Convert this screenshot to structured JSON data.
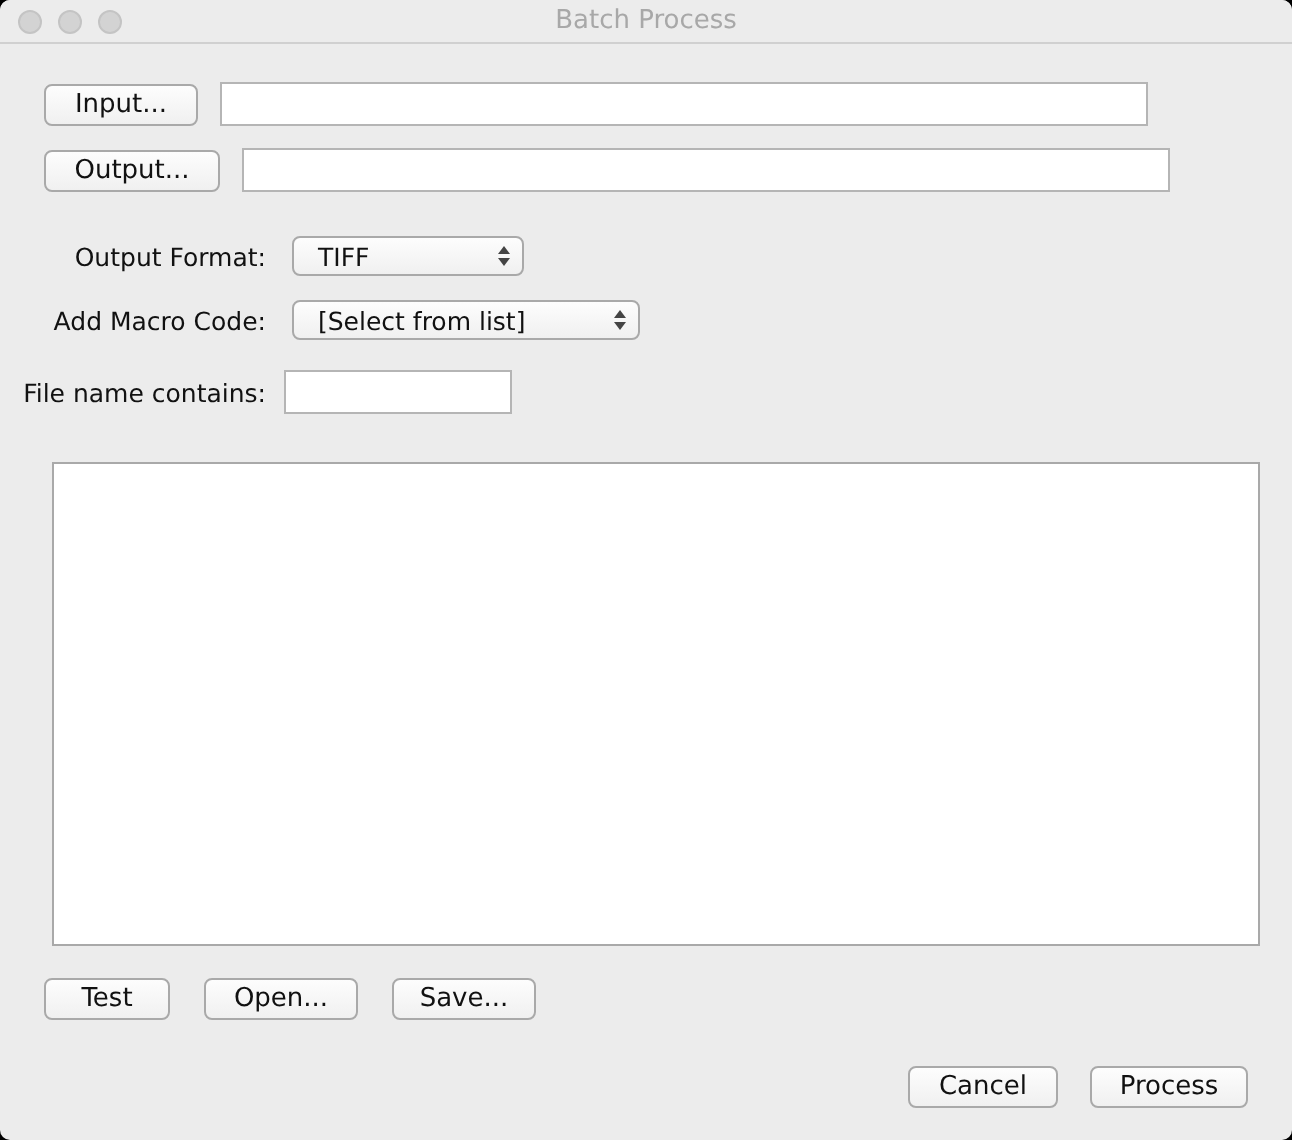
{
  "window": {
    "title": "Batch Process"
  },
  "input": {
    "button": "Input..."
  },
  "output": {
    "button": "Output..."
  },
  "output_format": {
    "label": "Output Format:",
    "value": "TIFF"
  },
  "macro_code": {
    "label": "Add Macro Code:",
    "value": "[Select from list]"
  },
  "file_name_filter": {
    "label": "File name contains:"
  },
  "macro_buttons": [
    "Test",
    "Open...",
    "Save..."
  ],
  "dialog_buttons": [
    "Cancel",
    "Process"
  ]
}
